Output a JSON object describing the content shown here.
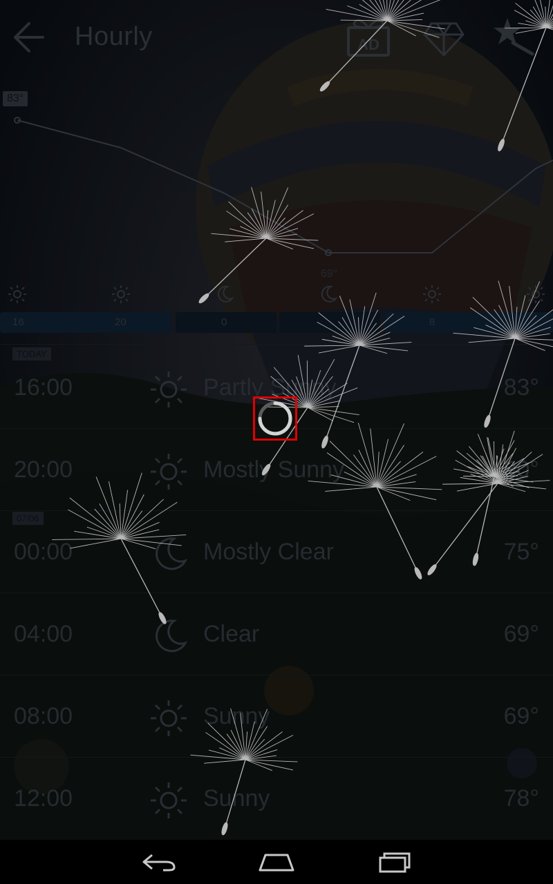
{
  "toolbar": {
    "title": "Hourly",
    "ad_label": "AD",
    "back_icon": "back-arrow-icon",
    "gift_icon": "gift-ad-icon",
    "gem_icon": "diamond-icon",
    "theme_icon": "theme-icon"
  },
  "graph": {
    "high_label": "83°",
    "low_label": "69°",
    "precip_labels": [
      "16",
      "20",
      "0",
      "8"
    ],
    "icons": [
      "sun-icon",
      "sun-icon",
      "moon-icon",
      "moon-icon",
      "sun-icon",
      "sun-icon"
    ]
  },
  "list": {
    "day_tags": [
      "TODAY",
      "07/06"
    ],
    "rows": [
      {
        "time": "16:00",
        "icon": "sun-icon",
        "condition": "Partly Sunny",
        "temp": "83°"
      },
      {
        "time": "20:00",
        "icon": "sun-icon",
        "condition": "Mostly Sunny",
        "temp": "80°"
      },
      {
        "time": "00:00",
        "icon": "moon-icon",
        "condition": "Mostly Clear",
        "temp": "75°"
      },
      {
        "time": "04:00",
        "icon": "moon-icon",
        "condition": "Clear",
        "temp": "69°"
      },
      {
        "time": "08:00",
        "icon": "sun-icon",
        "condition": "Sunny",
        "temp": "69°"
      },
      {
        "time": "12:00",
        "icon": "sun-icon",
        "condition": "Sunny",
        "temp": "78°"
      }
    ]
  },
  "colors": {
    "dim_text": "#262b31",
    "highlight": "#e00000",
    "spinner": "#cfcfcf"
  },
  "navbar": {
    "back_icon": "nav-back-icon",
    "home_icon": "nav-home-icon",
    "recents_icon": "nav-recents-icon"
  }
}
